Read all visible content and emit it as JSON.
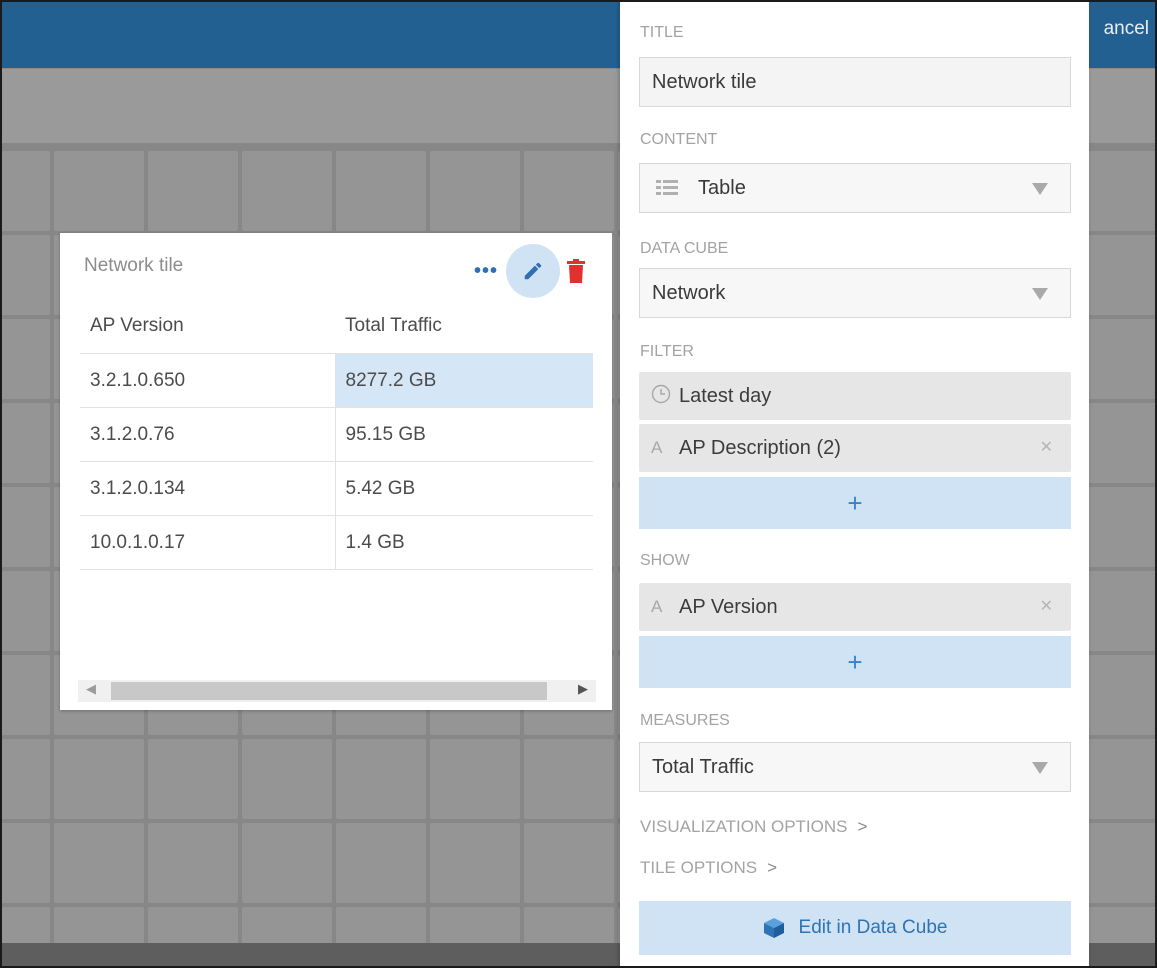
{
  "header": {
    "cancel_label": "ancel"
  },
  "tile": {
    "title": "Network tile",
    "columns": [
      "AP Version",
      "Total Traffic"
    ],
    "rows": [
      {
        "version": "3.2.1.0.650",
        "traffic": "8277.2 GB"
      },
      {
        "version": "3.1.2.0.76",
        "traffic": "95.15 GB"
      },
      {
        "version": "3.1.2.0.134",
        "traffic": "5.42 GB"
      },
      {
        "version": "10.0.1.0.17",
        "traffic": "1.4 GB"
      }
    ],
    "icons": {
      "more": "more-icon",
      "edit": "pencil-icon",
      "delete": "trash-icon"
    },
    "colors": {
      "edit_bg": "#cfe3f5",
      "delete": "#e0312f",
      "selected_cell": "#d5e6f6"
    }
  },
  "panel": {
    "title_label": "TITLE",
    "title_value": "Network tile",
    "content_label": "CONTENT",
    "content_value": "Table",
    "datacube_label": "DATA CUBE",
    "datacube_value": "Network",
    "filter_label": "FILTER",
    "filters": [
      {
        "icon": "clock-icon",
        "label": "Latest day",
        "removable": false
      },
      {
        "icon": "text-attribute-icon",
        "label": "AP Description (2)",
        "removable": true
      }
    ],
    "add_symbol": "+",
    "show_label": "SHOW",
    "show_items": [
      {
        "icon": "text-attribute-icon",
        "label": "AP Version",
        "removable": true
      }
    ],
    "measures_label": "MEASURES",
    "measures_value": "Total Traffic",
    "visualization_options": "VISUALIZATION OPTIONS",
    "tile_options": "TILE OPTIONS",
    "edit_button": "Edit in Data Cube",
    "accent": "#236092"
  }
}
